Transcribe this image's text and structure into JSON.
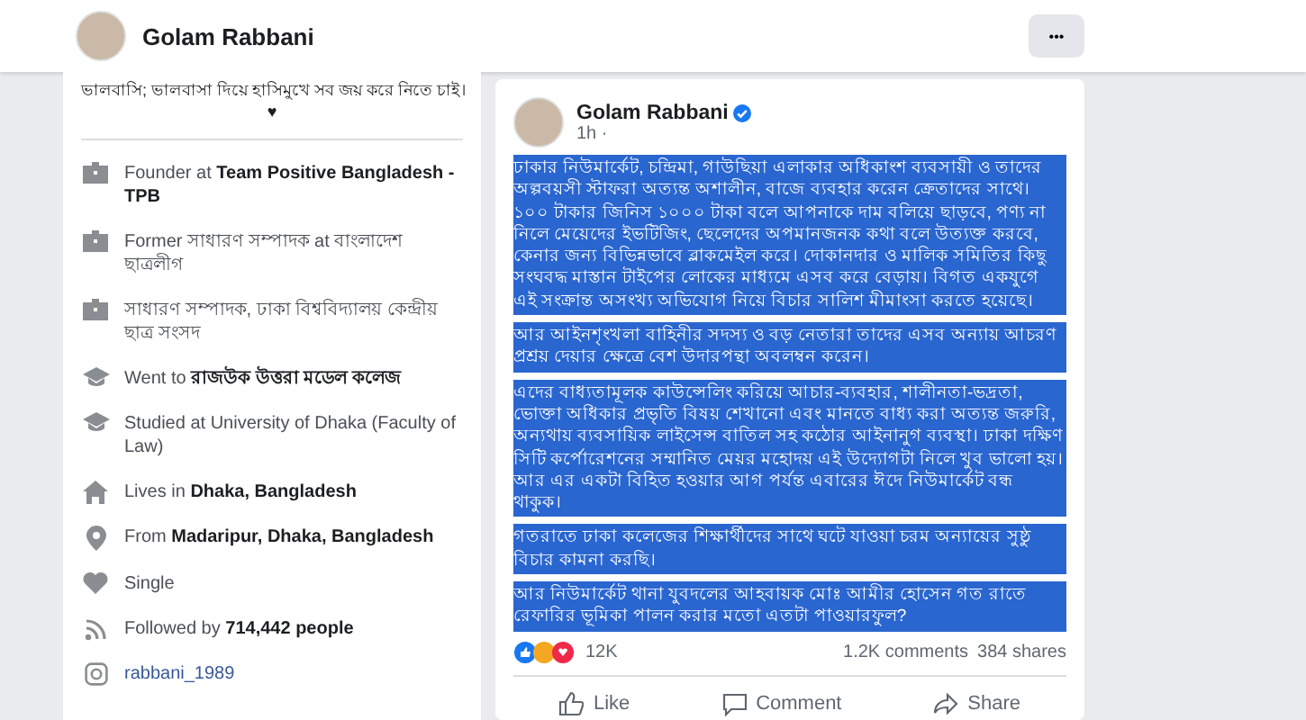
{
  "header": {
    "name": "Golam Rabbani",
    "more_button": "•••"
  },
  "intro": {
    "bio": [
      "ভালবাসি; ভালবাসা দিয়ে হাসিমুখে সব জয় করে নিতে চাই।",
      "♥"
    ],
    "items": [
      {
        "kind": "work",
        "text": "Founder at **Team Positive Bangladesh - TPB**"
      },
      {
        "kind": "work",
        "text": "Former সাধারণ সম্পাদক at বাংলাদেশ ছাত্রলীগ"
      },
      {
        "kind": "work",
        "text": "সাধারণ সম্পাদক, ঢাকা বিশ্ববিদ্যালয় কেন্দ্রীয় ছাত্র সংসদ"
      },
      {
        "kind": "school",
        "text": "Went to **রাজউক উত্তরা মডেল কলেজ**"
      },
      {
        "kind": "school",
        "text": "Studied at University of Dhaka (Faculty of Law)"
      },
      {
        "kind": "home",
        "text": "Lives in **Dhaka, Bangladesh**"
      },
      {
        "kind": "place",
        "text": "From **Madaripur, Dhaka, Bangladesh**"
      },
      {
        "kind": "relationship",
        "text": "Single"
      },
      {
        "kind": "followers",
        "text": "Followed by **714,442 people**"
      },
      {
        "kind": "instagram",
        "text": "rabbani_1989"
      }
    ]
  },
  "post": {
    "author": "Golam Rabbani",
    "verified": true,
    "time": "1h ·",
    "text_selected": true,
    "paragraphs": [
      "ঢাকার নিউমার্কেট, চন্দ্রিমা, গাউছিয়া এলাকার অধিকাংশ ব্যবসায়ী ও তাদের অল্পবয়সী স্টাফরা অত্যন্ত অশালীন, বাজে ব্যবহার করেন ক্রেতাদের সাথে। ১০০ টাকার জিনিস ১০০০ টাকা বলে আপনাকে দাম বলিয়ে ছাড়বে, পণ্য না নিলে মেয়েদের ইভটিজিং, ছেলেদের অপমানজনক কথা বলে উত্যক্ত করবে, কেনার জন্য বিভিন্নভাবে ব্লাকমেইল করে। দোকানদার ও মালিক সমিতির কিছু সংঘবদ্ধ মাস্তান টাইপের লোকের মাধ্যমে এসব করে বেড়ায়। বিগত একযুগে এই সংক্রান্ত অসংখ্য অভিযোগ নিয়ে বিচার সালিশ মীমাংসা করতে হয়েছে।",
      "আর আইনশৃংখলা বাহিনীর সদস্য ও বড় নেতারা তাদের এসব অন্যায় আচরণ প্রশ্রয় দেয়ার ক্ষেত্রে বেশ উদারপন্থা অবলম্বন করেন।",
      "এদের বাধ্যতামূলক কাউন্সেলিং করিয়ে আচার-ব্যবহার, শালীনতা-ভদ্রতা, ভোক্তা অধিকার প্রভৃতি বিষয় শেখানো এবং মানতে বাধ্য করা অত্যন্ত জরুরি, অন্যথায় ব্যবসায়িক লাইসেন্স বাতিল সহ কঠোর আইনানুগ ব্যবস্থা। ঢাকা দক্ষিণ সিটি কর্পোরেশনের সম্মানিত মেয়র মহোদয় এই উদ্যোগটা নিলে খুব ভালো হয়। আর এর একটা বিহিত হওয়ার আগ পর্যন্ত এবারের ঈদে নিউমার্কেট বন্ধ থাকুক।",
      "গতরাতে ঢাকা কলেজের শিক্ষার্থীদের সাথে ঘটে যাওয়া চরম অন্যায়ের সুষ্ঠু বিচার কামনা করছি।",
      "আর নিউমার্কেট থানা যুবদলের আহবায়ক মোঃ আমীর হোসেন গত রাতে রেফারির ভূমিকা পালন করার মতো এতটা পাওয়ারফুল?"
    ],
    "reactions": {
      "count": "12K",
      "comments": "1.2K comments",
      "shares": "384 shares"
    },
    "actions": [
      {
        "kind": "like",
        "label": "Like"
      },
      {
        "kind": "comment",
        "label": "Comment"
      },
      {
        "kind": "share",
        "label": "Share"
      }
    ]
  }
}
